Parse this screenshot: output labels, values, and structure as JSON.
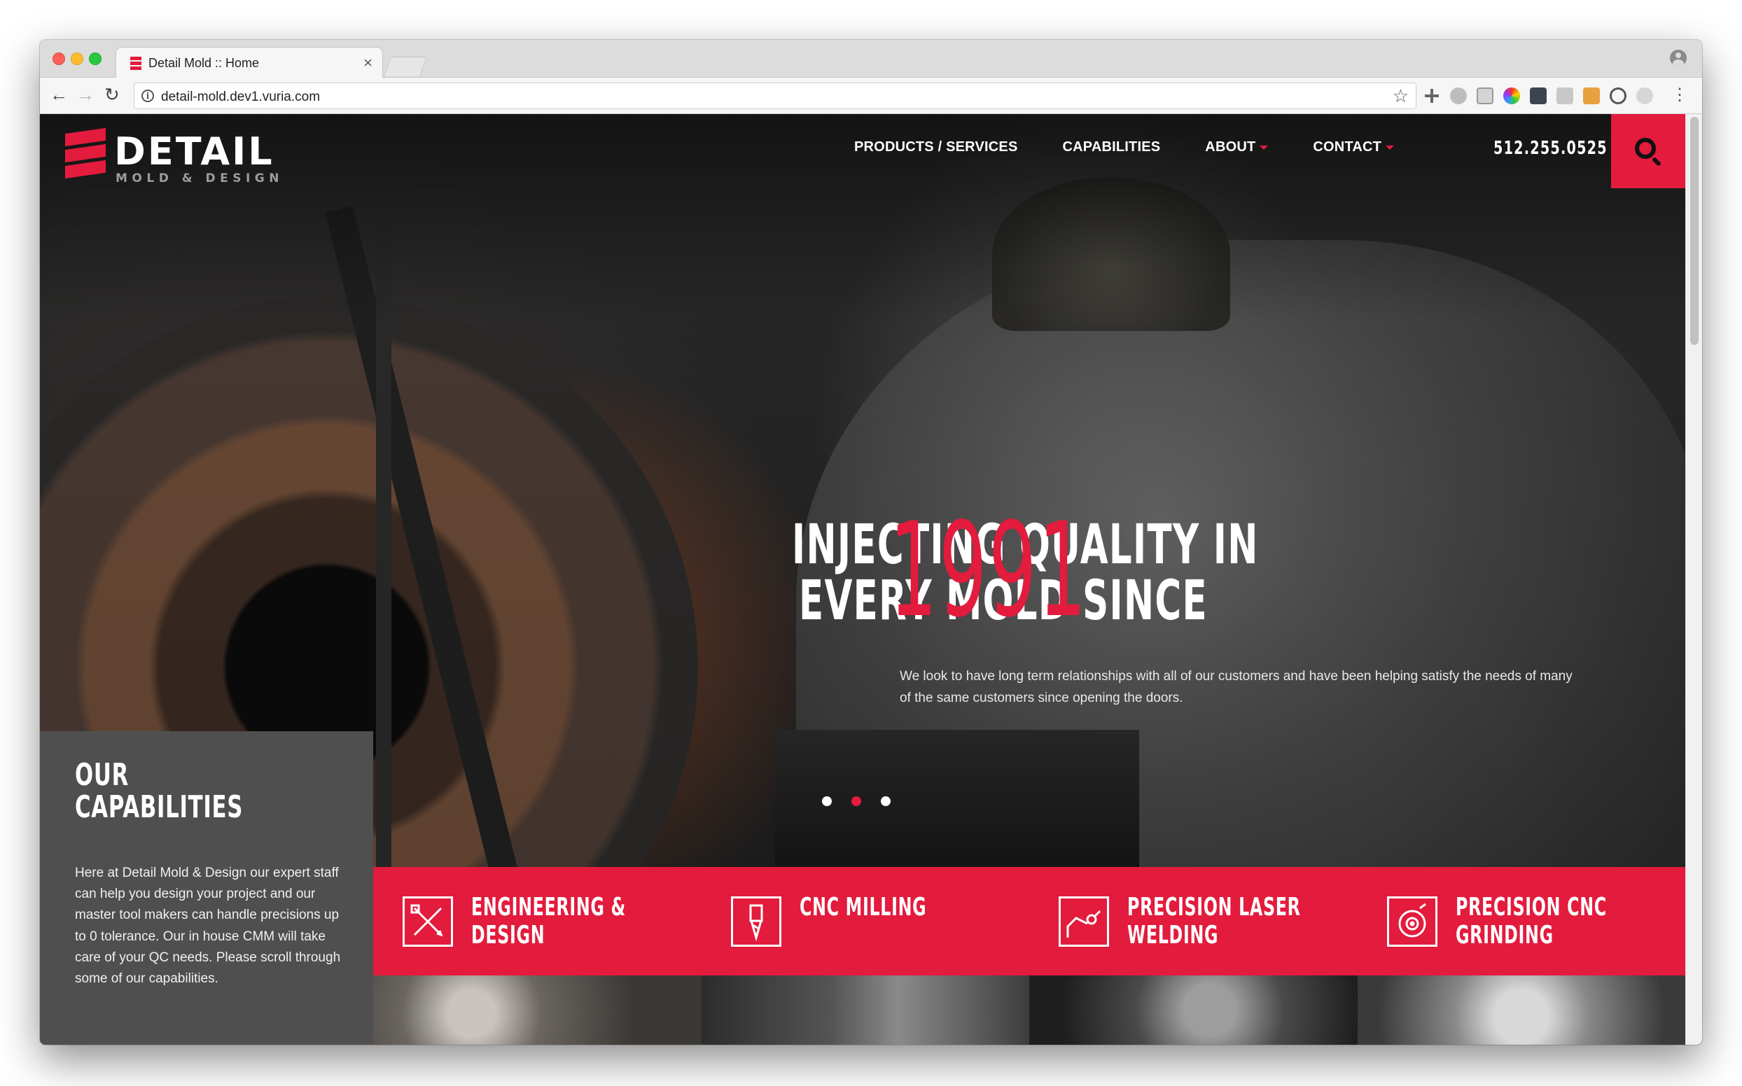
{
  "browser": {
    "tab_title": "Detail Mold :: Home",
    "tab_close": "×",
    "url": "detail-mold.dev1.vuria.com",
    "extensions": [
      "move-icon",
      "gear-badge-icon",
      "grid-icon",
      "color-wheel-icon",
      "terminal-icon",
      "camera-icon",
      "tag-icon",
      "sync-icon",
      "feather-icon"
    ]
  },
  "site": {
    "logo": {
      "word": "DETAIL",
      "sub": "MOLD & DESIGN"
    },
    "nav": [
      {
        "label": "PRODUCTS / SERVICES",
        "dropdown": false
      },
      {
        "label": "CAPABILITIES",
        "dropdown": false
      },
      {
        "label": "ABOUT",
        "dropdown": true
      },
      {
        "label": "CONTACT",
        "dropdown": true
      }
    ],
    "phone": "512.255.0525",
    "accent_color": "#e31b3d"
  },
  "hero": {
    "headline_line1": "INJECTING QUALITY IN",
    "headline_line2": "EVERY MOLD SINCE",
    "year": "1991",
    "text": "We look to have long term relationships with all of our customers and have been helping satisfy the needs of many of the same customers since opening the doors.",
    "slides": 3,
    "active_slide": 2
  },
  "capabilities": {
    "title_line1": "OUR",
    "title_line2": "CAPABILITIES",
    "description": "Here at Detail Mold & Design our expert staff can help you design your project and our master tool makers can handle precisions up to 0 tolerance. Our in house CMM will take care of your QC needs. Please scroll through some of our capabilities."
  },
  "services": [
    {
      "line1": "ENGINEERING &",
      "line2": "DESIGN",
      "icon": "ruler-pencil-icon"
    },
    {
      "line1": "CNC MILLING",
      "line2": "",
      "icon": "end-mill-icon"
    },
    {
      "line1": "PRECISION LASER",
      "line2": "WELDING",
      "icon": "laser-arm-icon"
    },
    {
      "line1": "PRECISION CNC",
      "line2": "GRINDING",
      "icon": "grinding-wheel-icon"
    }
  ]
}
